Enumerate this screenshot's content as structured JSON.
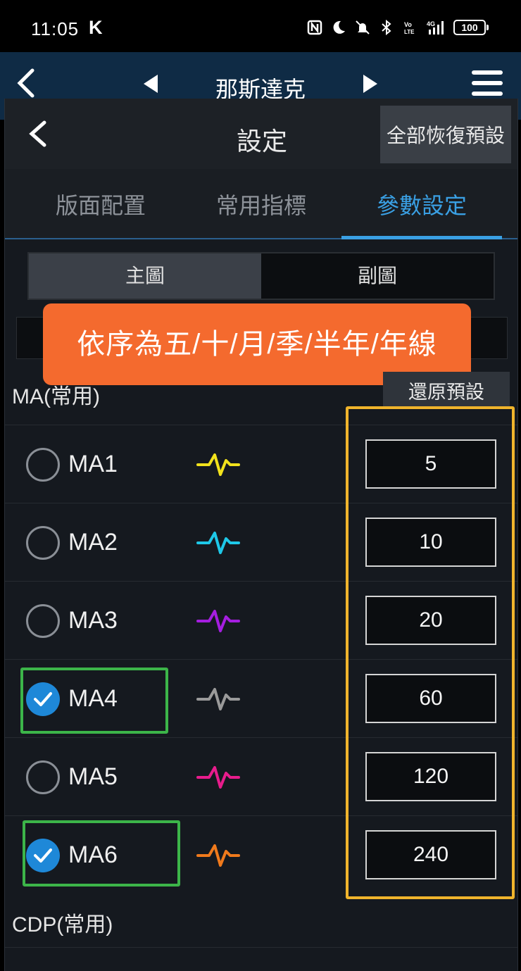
{
  "status_bar": {
    "time": "11:05",
    "carrier_icon": "K",
    "icons": [
      "nfc-icon",
      "moon-icon",
      "mute-icon",
      "bluetooth-icon",
      "volte-icon",
      "4g-signal-icon"
    ],
    "battery": "100"
  },
  "app_header": {
    "title": "那斯達克",
    "icons": [
      "back-arrow-icon",
      "prev-triangle-icon",
      "next-triangle-icon",
      "hamburger-menu-icon"
    ]
  },
  "dialog": {
    "title": "設定",
    "restore_all_label": "全部恢復預設",
    "tabs": [
      {
        "label": "版面配置",
        "active": false
      },
      {
        "label": "常用指標",
        "active": false
      },
      {
        "label": "參數設定",
        "active": true
      }
    ],
    "segments": [
      {
        "label": "主圖",
        "active": true
      },
      {
        "label": "副圖",
        "active": false
      }
    ],
    "annotation": "依序為五/十/月/季/半年/年線",
    "ma_section": {
      "title": "MA(常用)",
      "restore_label": "還原預設",
      "rows": [
        {
          "label": "MA1",
          "checked": false,
          "color": "#f2e21c",
          "value": "5"
        },
        {
          "label": "MA2",
          "checked": false,
          "color": "#1ec8e8",
          "value": "10"
        },
        {
          "label": "MA3",
          "checked": false,
          "color": "#a51ee0",
          "value": "20"
        },
        {
          "label": "MA4",
          "checked": true,
          "color": "#9a9a9a",
          "value": "60"
        },
        {
          "label": "MA5",
          "checked": false,
          "color": "#e81c8c",
          "value": "120"
        },
        {
          "label": "MA6",
          "checked": true,
          "color": "#f07a1c",
          "value": "240"
        }
      ]
    },
    "cdp_section": {
      "title": "CDP(常用)"
    }
  },
  "colors": {
    "accent": "#3aa0e4",
    "annotation_bg": "#f46a2e",
    "highlight_green": "#3cb549",
    "highlight_yellow": "#f0b42c"
  }
}
